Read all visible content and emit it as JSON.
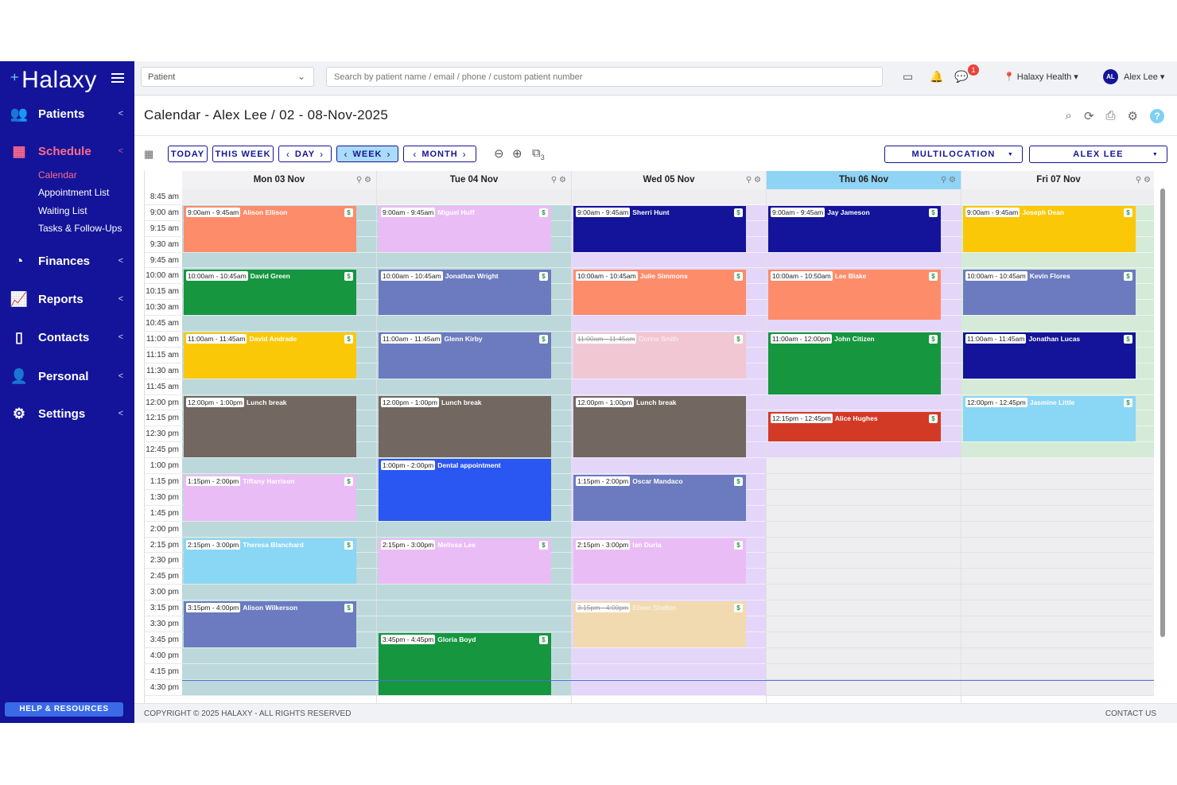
{
  "sidebar": {
    "logo": "Halaxy",
    "items": [
      {
        "label": "Patients",
        "icon": "users-icon"
      },
      {
        "label": "Schedule",
        "icon": "calendar-icon",
        "active": true
      },
      {
        "label": "Finances",
        "icon": "pie-chart-icon"
      },
      {
        "label": "Reports",
        "icon": "line-chart-icon"
      },
      {
        "label": "Contacts",
        "icon": "contacts-book-icon"
      },
      {
        "label": "Personal",
        "icon": "person-icon"
      },
      {
        "label": "Settings",
        "icon": "gear-icon"
      }
    ],
    "schedule_sub": [
      "Calendar",
      "Appointment List",
      "Waiting List",
      "Tasks & Follow-Ups"
    ],
    "help": "HELP & RESOURCES"
  },
  "topbar": {
    "patient_select": "Patient",
    "search_placeholder": "Search by patient name / email / phone / custom patient number",
    "notification_count": "1",
    "location": "Halaxy Health",
    "user_initials": "AL",
    "user_name": "Alex Lee"
  },
  "header": {
    "title": "Calendar - Alex Lee / 02 - 08-Nov-2025"
  },
  "toolbar": {
    "today": "TODAY",
    "this_week": "THIS WEEK",
    "day": "DAY",
    "week": "WEEK",
    "month": "MONTH",
    "resource_count": "3",
    "multilocation": "MULTILOCATION",
    "practitioner": "ALEX LEE"
  },
  "times": [
    "8:45 am",
    "9:00 am",
    "9:15 am",
    "9:30 am",
    "9:45 am",
    "10:00 am",
    "10:15 am",
    "10:30 am",
    "10:45 am",
    "11:00 am",
    "11:15 am",
    "11:30 am",
    "11:45 am",
    "12:00 pm",
    "12:15 pm",
    "12:30 pm",
    "12:45 pm",
    "1:00 pm",
    "1:15 pm",
    "1:30 pm",
    "1:45 pm",
    "2:00 pm",
    "2:15 pm",
    "2:30 pm",
    "2:45 pm",
    "3:00 pm",
    "3:15 pm",
    "3:30 pm",
    "3:45 pm",
    "4:00 pm",
    "4:15 pm",
    "4:30 pm"
  ],
  "days": [
    {
      "label": "Mon 03 Nov",
      "bg": "#bcd8da",
      "head": "#f2f2f5",
      "end": 32,
      "appts": [
        {
          "time": "9:00am - 9:45am",
          "name": "Alison Ellison",
          "start": 1,
          "len": 3,
          "color": "#fd8c6b"
        },
        {
          "time": "10:00am - 10:45am",
          "name": "David Green",
          "start": 5,
          "len": 3,
          "color": "#15963f"
        },
        {
          "time": "11:00am - 11:45am",
          "name": "David Andrade",
          "start": 9,
          "len": 3,
          "color": "#fbc808"
        },
        {
          "time": "12:00pm - 1:00pm",
          "name": "Lunch break",
          "start": 13,
          "len": 4,
          "color": "#726861",
          "nopay": true
        },
        {
          "time": "1:15pm - 2:00pm",
          "name": "Tiffany Harrison",
          "start": 18,
          "len": 3,
          "color": "#eabcf5"
        },
        {
          "time": "2:15pm - 3:00pm",
          "name": "Theresa Blanchard",
          "start": 22,
          "len": 3,
          "color": "#8ad6f5"
        },
        {
          "time": "3:15pm - 4:00pm",
          "name": "Alison Wilkerson",
          "start": 26,
          "len": 3,
          "color": "#6c7bbf"
        }
      ]
    },
    {
      "label": "Tue 04 Nov",
      "bg": "#bcd8da",
      "head": "#f2f2f5",
      "end": 32,
      "appts": [
        {
          "time": "9:00am - 9:45am",
          "name": "Miguel Huff",
          "start": 1,
          "len": 3,
          "color": "#eabcf5"
        },
        {
          "time": "10:00am - 10:45am",
          "name": "Jonathan Wright",
          "start": 5,
          "len": 3,
          "color": "#6c7bbf"
        },
        {
          "time": "11:00am - 11:45am",
          "name": "Glenn Kirby",
          "start": 9,
          "len": 3,
          "color": "#6c7bbf"
        },
        {
          "time": "12:00pm - 1:00pm",
          "name": "Lunch break",
          "start": 13,
          "len": 4,
          "color": "#726861",
          "nopay": true
        },
        {
          "time": "1:00pm - 2:00pm",
          "name": "Dental appointment",
          "start": 17,
          "len": 4,
          "color": "#2a56f2",
          "nopay": true
        },
        {
          "time": "2:15pm - 3:00pm",
          "name": "Melissa Lee",
          "start": 22,
          "len": 3,
          "color": "#eabcf5"
        },
        {
          "time": "3:45pm - 4:45pm",
          "name": "Gloria Boyd",
          "start": 28,
          "len": 4,
          "color": "#15963f"
        }
      ]
    },
    {
      "label": "Wed 05 Nov",
      "bg": "#e4d6f8",
      "head": "#f2f2f5",
      "end": 32,
      "appts": [
        {
          "time": "9:00am - 9:45am",
          "name": "Sherri Hunt",
          "start": 1,
          "len": 3,
          "color": "#14149a"
        },
        {
          "time": "10:00am - 10:45am",
          "name": "Julie Simmons",
          "start": 5,
          "len": 3,
          "color": "#fd8c6b"
        },
        {
          "time": "11:00am - 11:45am",
          "name": "Donna Smith",
          "start": 9,
          "len": 3,
          "color": "#f1c7d3",
          "cancelled": true
        },
        {
          "time": "12:00pm - 1:00pm",
          "name": "Lunch break",
          "start": 13,
          "len": 4,
          "color": "#726861",
          "nopay": true
        },
        {
          "time": "1:15pm - 2:00pm",
          "name": "Oscar Mandaco",
          "start": 18,
          "len": 3,
          "color": "#6c7bbf"
        },
        {
          "time": "2:15pm - 3:00pm",
          "name": "Ian Duria",
          "start": 22,
          "len": 3,
          "color": "#eabcf5"
        },
        {
          "time": "3:15pm - 4:00pm",
          "name": "Eileen Shelton",
          "start": 26,
          "len": 3,
          "color": "#f2dab0",
          "cancelled": true
        }
      ]
    },
    {
      "label": "Thu 06 Nov",
      "bg": "#e4d6f8",
      "head": "#8fd3f5",
      "end": 17,
      "appts": [
        {
          "time": "9:00am - 9:45am",
          "name": "Jay Jameson",
          "start": 1,
          "len": 3,
          "color": "#14149a"
        },
        {
          "time": "10:00am - 10:50am",
          "name": "Lee Blake",
          "start": 5,
          "len": 3.3,
          "color": "#fd8c6b"
        },
        {
          "time": "11:00am - 12:00pm",
          "name": "John Citizen",
          "start": 9,
          "len": 4,
          "color": "#15963f"
        },
        {
          "time": "12:15pm - 12:45pm",
          "name": "Alice Hughes",
          "start": 14,
          "len": 2,
          "color": "#d33a26"
        }
      ]
    },
    {
      "label": "Fri 07 Nov",
      "bg": "#d5ead7",
      "head": "#f2f2f5",
      "end": 17,
      "appts": [
        {
          "time": "9:00am - 9:45am",
          "name": "Joseph Dean",
          "start": 1,
          "len": 3,
          "color": "#fbc808"
        },
        {
          "time": "10:00am - 10:45am",
          "name": "Kevin Flores",
          "start": 5,
          "len": 3,
          "color": "#6c7bbf"
        },
        {
          "time": "11:00am - 11:45am",
          "name": "Jonathan Lucas",
          "start": 9,
          "len": 3,
          "color": "#14149a"
        },
        {
          "time": "12:00pm - 12:45pm",
          "name": "Jasmine Little",
          "start": 13,
          "len": 3,
          "color": "#8ad6f5"
        }
      ]
    }
  ],
  "footer": {
    "copyright": "COPYRIGHT © 2025 HALAXY - ALL RIGHTS RESERVED",
    "contact": "CONTACT US"
  }
}
